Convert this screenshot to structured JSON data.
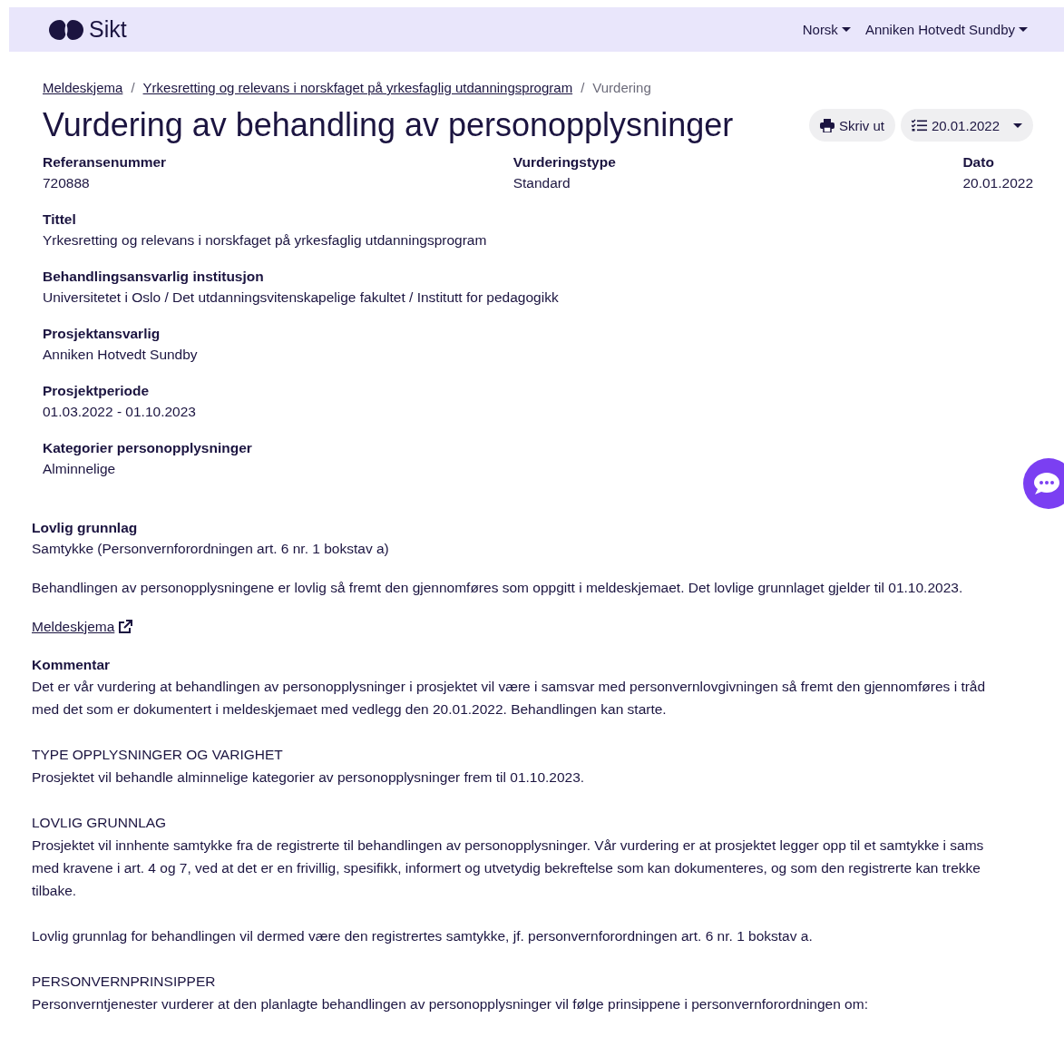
{
  "header": {
    "logo_text": "Sikt",
    "menus": [
      {
        "label": "Norsk"
      },
      {
        "label": "Anniken Hotvedt Sundby"
      }
    ]
  },
  "breadcrumb_separator": "/",
  "breadcrumb": [
    {
      "label": "Meldeskjema",
      "current": false
    },
    {
      "label": "Yrkesretting og relevans i norskfaget på yrkesfaglig utdanningsprogram",
      "current": false
    },
    {
      "label": "Vurdering",
      "current": true
    }
  ],
  "title": "Vurdering av behandling av personopplysninger",
  "actions": {
    "print": "Skriv ut",
    "version": "20.01.2022"
  },
  "summary": [
    {
      "label": "Referansenummer",
      "value": "720888"
    },
    {
      "label": "Vurderingstype",
      "value": "Standard"
    },
    {
      "label": "Dato",
      "value": "20.01.2022"
    }
  ],
  "fields": [
    {
      "label": "Tittel",
      "value": "Yrkesretting og relevans i norskfaget på yrkesfaglig utdanningsprogram"
    },
    {
      "label": "Behandlingsansvarlig institusjon",
      "value": "Universitetet i Oslo / Det utdanningsvitenskapelige fakultet / Institutt for pedagogikk"
    },
    {
      "label": "Prosjektansvarlig",
      "value": "Anniken Hotvedt Sundby"
    },
    {
      "label": "Prosjektperiode",
      "value": "01.03.2022 - 01.10.2023"
    },
    {
      "label": "Kategorier personopplysninger",
      "value": "Alminnelige"
    }
  ],
  "legal_basis": {
    "heading": "Lovlig grunnlag",
    "value": "Samtykke (Personvernforordningen art. 6 nr. 1 bokstav a)",
    "statement": "Behandlingen av personopplysningene er lovlig så fremt den gjennomføres som oppgitt i meldeskjemaet. Det lovlige grunnlaget gjelder til 01.10.2023.",
    "link": "Meldeskjema"
  },
  "comment": {
    "heading": "Kommentar",
    "paragraphs": [
      {
        "lines": [
          "Det er vår vurdering at behandlingen av personopplysninger i prosjektet vil være i samsvar med personvernlovgivningen så fremt den gjennomføres i tråd",
          "med det som er dokumentert i meldeskjemaet med vedlegg den 20.01.2022. Behandlingen kan starte."
        ]
      },
      {
        "lines": [
          "TYPE OPPLYSNINGER OG VARIGHET",
          "Prosjektet vil behandle alminnelige kategorier av personopplysninger frem til 01.10.2023."
        ]
      },
      {
        "lines": [
          "LOVLIG GRUNNLAG",
          "Prosjektet vil innhente samtykke fra de registrerte til behandlingen av personopplysninger. Vår vurdering er at prosjektet legger opp til et samtykke i sams",
          "med kravene i art. 4 og 7, ved at det er en frivillig, spesifikk, informert og utvetydig bekreftelse som kan dokumenteres, og som den registrerte kan trekke",
          "tilbake."
        ]
      },
      {
        "lines": [
          "Lovlig grunnlag for behandlingen vil dermed være den registrertes samtykke, jf. personvernforordningen art. 6 nr. 1 bokstav a."
        ]
      },
      {
        "lines": [
          "PERSONVERNPRINSIPPER",
          "Personverntjenester vurderer at den planlagte behandlingen av personopplysninger vil følge prinsippene i personvernforordningen om:"
        ]
      }
    ]
  }
}
